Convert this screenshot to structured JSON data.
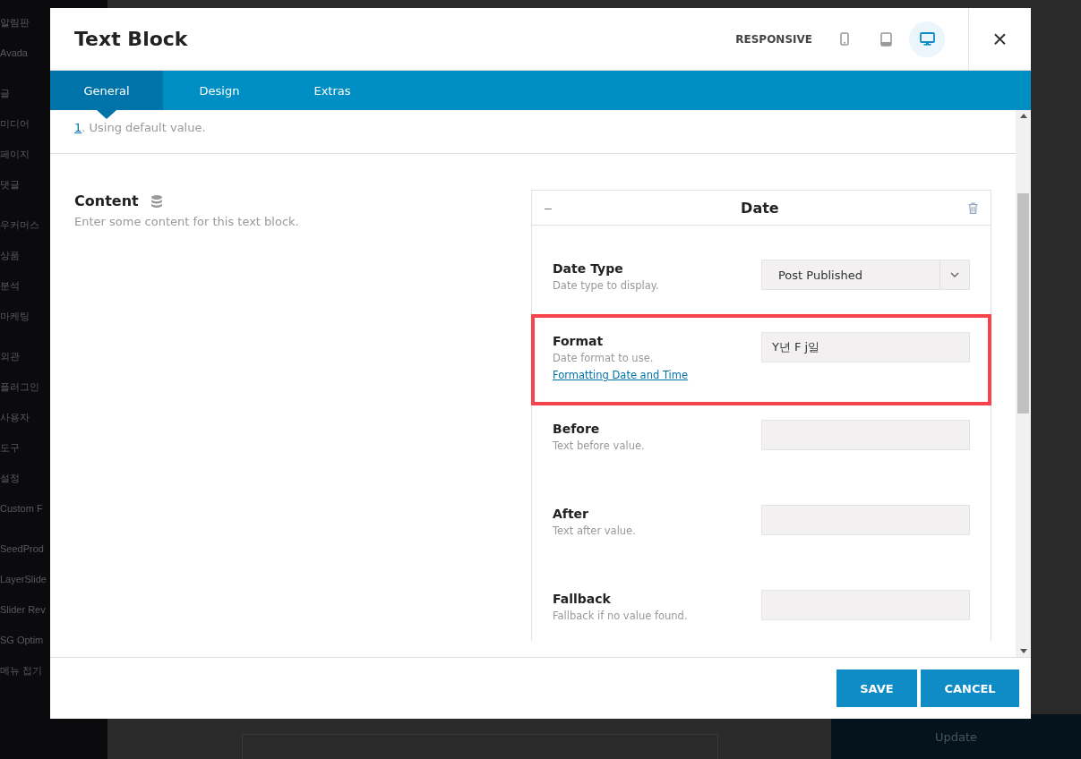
{
  "sidebar": {
    "groups": [
      [
        "알림판",
        "Avada"
      ],
      [
        "글",
        "미디어",
        "페이지",
        "댓글"
      ],
      [
        "우커머스",
        "상품",
        "분석",
        "마케팅"
      ],
      [
        "외관",
        "플러그인",
        "사용자",
        "도구",
        "설정",
        "Custom F"
      ],
      [
        "SeedProd",
        "LayerSlide",
        "Slider Rev",
        "SG Optim",
        "메뉴 접기"
      ]
    ]
  },
  "background": {
    "update_button": "Update"
  },
  "dialog": {
    "title": "Text Block",
    "responsive_label": "RESPONSIVE",
    "devices": [
      {
        "kind": "phone",
        "selected": false
      },
      {
        "kind": "tablet",
        "selected": false
      },
      {
        "kind": "desktop",
        "selected": true
      }
    ],
    "close": "×",
    "tabs": [
      {
        "label": "General",
        "selected": true
      },
      {
        "label": "Design",
        "selected": false
      },
      {
        "label": "Extras",
        "selected": false
      }
    ],
    "previous_note": {
      "mark": "1",
      "text": ". Using default value."
    },
    "content": {
      "title": "Content",
      "description": "Enter some content for this text block.",
      "panel": {
        "title": "Date",
        "collapse": "–",
        "fields": [
          {
            "kind": "select",
            "label": "Date Type",
            "description": "Date type to display.",
            "value": "Post Published",
            "highlighted": false
          },
          {
            "kind": "text",
            "label": "Format",
            "description": "Date format to use.",
            "link": "Formatting Date and Time",
            "value": "Y년 F j일",
            "highlighted": true
          },
          {
            "kind": "text",
            "label": "Before",
            "description": "Text before value.",
            "highlighted": false
          },
          {
            "kind": "text",
            "label": "After",
            "description": "Text after value.",
            "highlighted": false
          },
          {
            "kind": "text",
            "label": "Fallback",
            "description": "Fallback if no value found.",
            "highlighted": false
          }
        ]
      }
    },
    "buttons": [
      {
        "kind": "save",
        "label": "SAVE"
      },
      {
        "kind": "cancel",
        "label": "CANCEL"
      }
    ]
  }
}
